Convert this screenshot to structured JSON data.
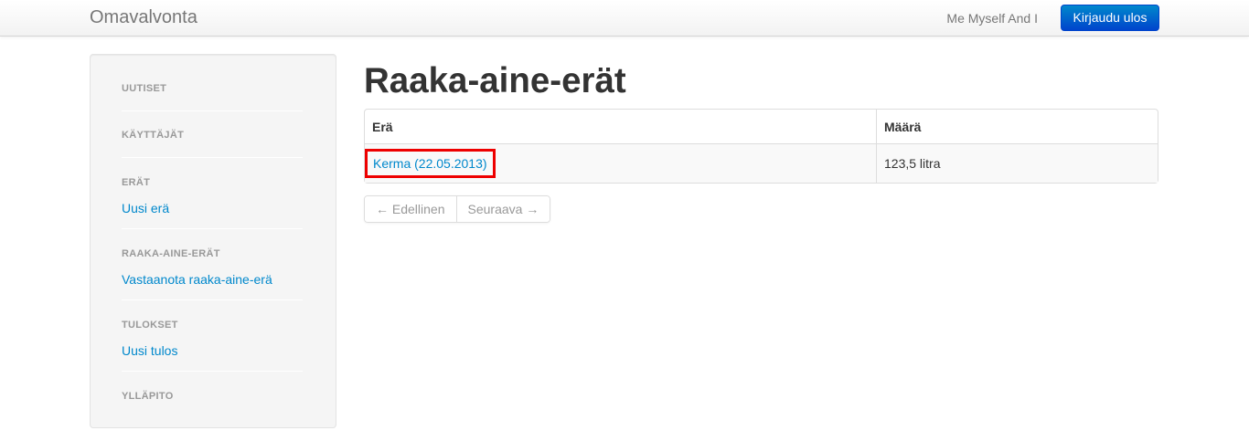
{
  "navbar": {
    "brand": "Omavalvonta",
    "user_name": "Me Myself And I",
    "logout_label": "Kirjaudu ulos"
  },
  "sidebar": {
    "sections": [
      {
        "header": "UUTISET",
        "links": []
      },
      {
        "header": "KÄYTTÄJÄT",
        "links": []
      },
      {
        "header": "ERÄT",
        "links": [
          "Uusi erä"
        ]
      },
      {
        "header": "RAAKA-AINE-ERÄT",
        "links": [
          "Vastaanota raaka-aine-erä"
        ]
      },
      {
        "header": "TULOKSET",
        "links": [
          "Uusi tulos"
        ]
      },
      {
        "header": "YLLÄPITO",
        "links": []
      }
    ]
  },
  "main": {
    "title": "Raaka-aine-erät",
    "table": {
      "columns": [
        "Erä",
        "Määrä"
      ],
      "rows": [
        {
          "name": "Kerma (22.05.2013)",
          "amount": "123,5 litra",
          "highlighted": true
        }
      ]
    },
    "pager": {
      "prev_label": "← Edellinen",
      "next_label": "Seuraava →"
    }
  },
  "colors": {
    "link": "#0088cc",
    "primary_button": "#0055cc",
    "highlight_box": "#ee0000",
    "muted_text": "#999999"
  }
}
